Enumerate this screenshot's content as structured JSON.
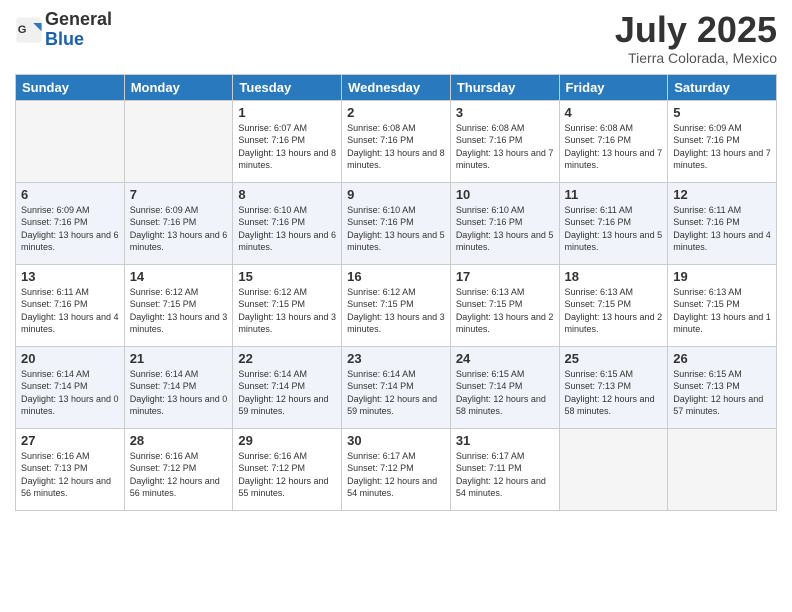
{
  "header": {
    "logo": {
      "line1": "General",
      "line2": "Blue"
    },
    "title": "July 2025",
    "subtitle": "Tierra Colorada, Mexico"
  },
  "weekdays": [
    "Sunday",
    "Monday",
    "Tuesday",
    "Wednesday",
    "Thursday",
    "Friday",
    "Saturday"
  ],
  "weeks": [
    [
      {
        "day": "",
        "info": ""
      },
      {
        "day": "",
        "info": ""
      },
      {
        "day": "1",
        "info": "Sunrise: 6:07 AM\nSunset: 7:16 PM\nDaylight: 13 hours and 8 minutes."
      },
      {
        "day": "2",
        "info": "Sunrise: 6:08 AM\nSunset: 7:16 PM\nDaylight: 13 hours and 8 minutes."
      },
      {
        "day": "3",
        "info": "Sunrise: 6:08 AM\nSunset: 7:16 PM\nDaylight: 13 hours and 7 minutes."
      },
      {
        "day": "4",
        "info": "Sunrise: 6:08 AM\nSunset: 7:16 PM\nDaylight: 13 hours and 7 minutes."
      },
      {
        "day": "5",
        "info": "Sunrise: 6:09 AM\nSunset: 7:16 PM\nDaylight: 13 hours and 7 minutes."
      }
    ],
    [
      {
        "day": "6",
        "info": "Sunrise: 6:09 AM\nSunset: 7:16 PM\nDaylight: 13 hours and 6 minutes."
      },
      {
        "day": "7",
        "info": "Sunrise: 6:09 AM\nSunset: 7:16 PM\nDaylight: 13 hours and 6 minutes."
      },
      {
        "day": "8",
        "info": "Sunrise: 6:10 AM\nSunset: 7:16 PM\nDaylight: 13 hours and 6 minutes."
      },
      {
        "day": "9",
        "info": "Sunrise: 6:10 AM\nSunset: 7:16 PM\nDaylight: 13 hours and 5 minutes."
      },
      {
        "day": "10",
        "info": "Sunrise: 6:10 AM\nSunset: 7:16 PM\nDaylight: 13 hours and 5 minutes."
      },
      {
        "day": "11",
        "info": "Sunrise: 6:11 AM\nSunset: 7:16 PM\nDaylight: 13 hours and 5 minutes."
      },
      {
        "day": "12",
        "info": "Sunrise: 6:11 AM\nSunset: 7:16 PM\nDaylight: 13 hours and 4 minutes."
      }
    ],
    [
      {
        "day": "13",
        "info": "Sunrise: 6:11 AM\nSunset: 7:16 PM\nDaylight: 13 hours and 4 minutes."
      },
      {
        "day": "14",
        "info": "Sunrise: 6:12 AM\nSunset: 7:15 PM\nDaylight: 13 hours and 3 minutes."
      },
      {
        "day": "15",
        "info": "Sunrise: 6:12 AM\nSunset: 7:15 PM\nDaylight: 13 hours and 3 minutes."
      },
      {
        "day": "16",
        "info": "Sunrise: 6:12 AM\nSunset: 7:15 PM\nDaylight: 13 hours and 3 minutes."
      },
      {
        "day": "17",
        "info": "Sunrise: 6:13 AM\nSunset: 7:15 PM\nDaylight: 13 hours and 2 minutes."
      },
      {
        "day": "18",
        "info": "Sunrise: 6:13 AM\nSunset: 7:15 PM\nDaylight: 13 hours and 2 minutes."
      },
      {
        "day": "19",
        "info": "Sunrise: 6:13 AM\nSunset: 7:15 PM\nDaylight: 13 hours and 1 minute."
      }
    ],
    [
      {
        "day": "20",
        "info": "Sunrise: 6:14 AM\nSunset: 7:14 PM\nDaylight: 13 hours and 0 minutes."
      },
      {
        "day": "21",
        "info": "Sunrise: 6:14 AM\nSunset: 7:14 PM\nDaylight: 13 hours and 0 minutes."
      },
      {
        "day": "22",
        "info": "Sunrise: 6:14 AM\nSunset: 7:14 PM\nDaylight: 12 hours and 59 minutes."
      },
      {
        "day": "23",
        "info": "Sunrise: 6:14 AM\nSunset: 7:14 PM\nDaylight: 12 hours and 59 minutes."
      },
      {
        "day": "24",
        "info": "Sunrise: 6:15 AM\nSunset: 7:14 PM\nDaylight: 12 hours and 58 minutes."
      },
      {
        "day": "25",
        "info": "Sunrise: 6:15 AM\nSunset: 7:13 PM\nDaylight: 12 hours and 58 minutes."
      },
      {
        "day": "26",
        "info": "Sunrise: 6:15 AM\nSunset: 7:13 PM\nDaylight: 12 hours and 57 minutes."
      }
    ],
    [
      {
        "day": "27",
        "info": "Sunrise: 6:16 AM\nSunset: 7:13 PM\nDaylight: 12 hours and 56 minutes."
      },
      {
        "day": "28",
        "info": "Sunrise: 6:16 AM\nSunset: 7:12 PM\nDaylight: 12 hours and 56 minutes."
      },
      {
        "day": "29",
        "info": "Sunrise: 6:16 AM\nSunset: 7:12 PM\nDaylight: 12 hours and 55 minutes."
      },
      {
        "day": "30",
        "info": "Sunrise: 6:17 AM\nSunset: 7:12 PM\nDaylight: 12 hours and 54 minutes."
      },
      {
        "day": "31",
        "info": "Sunrise: 6:17 AM\nSunset: 7:11 PM\nDaylight: 12 hours and 54 minutes."
      },
      {
        "day": "",
        "info": ""
      },
      {
        "day": "",
        "info": ""
      }
    ]
  ]
}
